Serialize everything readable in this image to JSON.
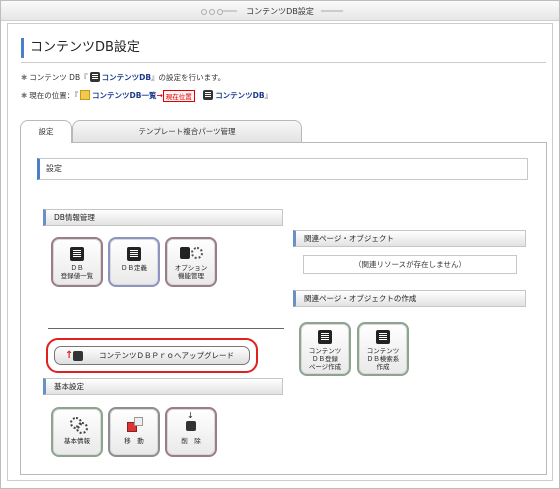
{
  "window": {
    "title": "コンテンツDB設定"
  },
  "page": {
    "title": "コンテンツDB設定",
    "info_prefix": "コンテンツ DB『",
    "info_link": "コンテンツDB",
    "info_suffix": "』の設定を行います。",
    "location_label": "現在の位置：『",
    "location_link": "コンテンツDB一覧",
    "location_arrow": "→",
    "location_tag": "現在位置",
    "location_current": "コンテンツDB",
    "location_end": "』"
  },
  "tabs": [
    {
      "label": "設定",
      "active": true
    },
    {
      "label": "テンプレート複合パーツ管理",
      "active": false
    }
  ],
  "panel": {
    "heading": "設定",
    "db_section": {
      "label": "DB情報管理",
      "buttons": [
        {
          "label_l1": "ＤＢ",
          "label_l2": "登録値一覧",
          "icon": "database-grid-icon"
        },
        {
          "label_l1": "ＤＢ定義",
          "icon": "database-grid-icon"
        },
        {
          "label_l1": "オプション",
          "label_l2": "機能管理",
          "icon": "options-gear-icon"
        }
      ]
    },
    "upgrade_button": "コンテンツＤＢＰｒｏへアップグレード",
    "basic_section": {
      "label": "基本設定",
      "buttons": [
        {
          "label": "基本情報",
          "icon": "gears-icon"
        },
        {
          "label": "移　動",
          "icon": "move-icon"
        },
        {
          "label": "削　除",
          "icon": "delete-icon"
        }
      ]
    },
    "related_section": {
      "label": "関連ページ・オブジェクト",
      "empty_text": "（関連リソースが存在しません）"
    },
    "create_section": {
      "label": "関連ページ・オブジェクトの作成",
      "buttons": [
        {
          "label_l1": "コンテンツ",
          "label_l2": "ＤＢ登録",
          "label_l3": "ページ作成",
          "icon": "register-page-icon"
        },
        {
          "label_l1": "コンテンツ",
          "label_l2": "ＤＢ検索系",
          "label_l3": "作成",
          "icon": "search-page-icon"
        }
      ]
    }
  }
}
